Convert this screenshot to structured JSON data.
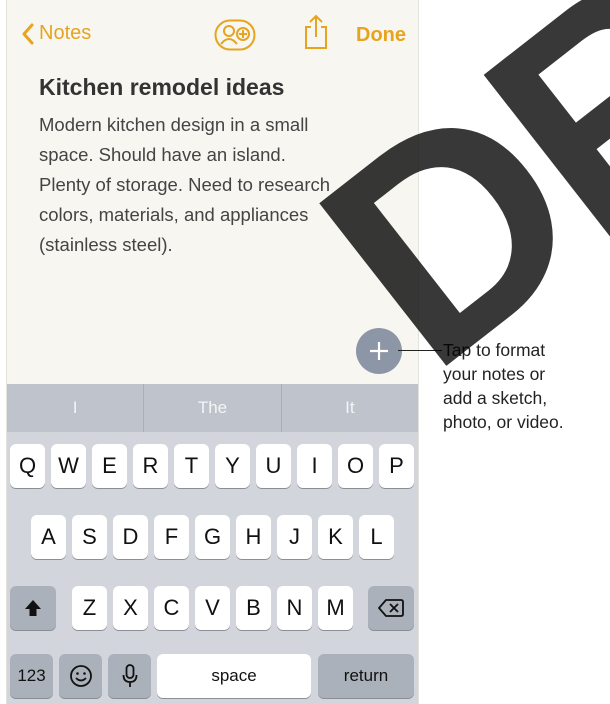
{
  "nav": {
    "back_label": "Notes",
    "done_label": "Done"
  },
  "note": {
    "title": "Kitchen remodel ideas",
    "lines": [
      "Modern kitchen design in a small",
      "space. Should have an island.",
      "Plenty of storage. Need to research",
      "colors, materials, and appliances",
      "(stainless steel)."
    ]
  },
  "suggestions": [
    "I",
    "The",
    "It"
  ],
  "keyboard": {
    "row1": [
      "Q",
      "W",
      "E",
      "R",
      "T",
      "Y",
      "U",
      "I",
      "O",
      "P"
    ],
    "row2": [
      "A",
      "S",
      "D",
      "F",
      "G",
      "H",
      "J",
      "K",
      "L"
    ],
    "row3": [
      "Z",
      "X",
      "C",
      "V",
      "B",
      "N",
      "M"
    ],
    "numbers_label": "123",
    "space_label": "space",
    "return_label": "return"
  },
  "callout": {
    "lines": [
      "Tap to format",
      "your notes or",
      "add a sketch,",
      "photo, or video."
    ]
  },
  "watermark": "DRAFT",
  "colors": {
    "accent": "#e6a41f",
    "keyboard": "#d2d5db",
    "note_bg": "#f7f6f1"
  }
}
